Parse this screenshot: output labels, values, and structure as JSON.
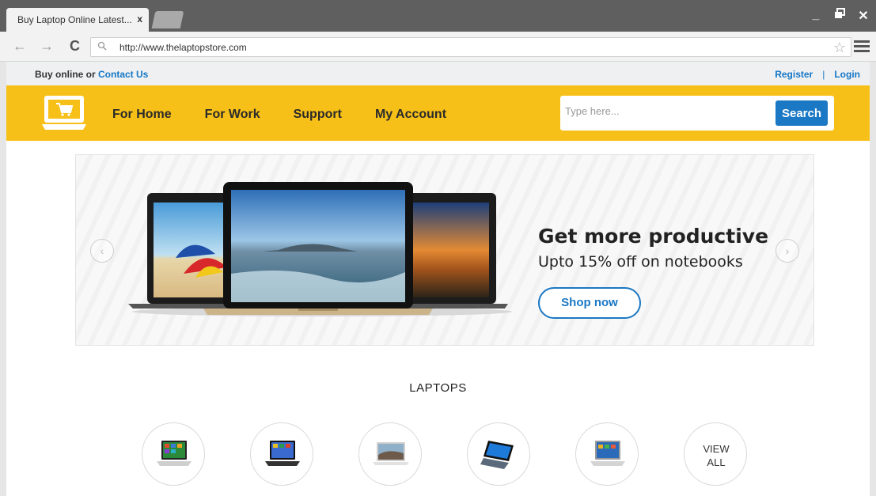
{
  "browser": {
    "tab_title": "Buy Laptop Online Latest...",
    "tab_close": "x",
    "url": "http://www.thelaptopstore.com",
    "icons": [
      "back-arrow-icon",
      "forward-arrow-icon",
      "reload-icon",
      "search-icon",
      "star-icon",
      "menu-icon",
      "minimize-icon",
      "restore-icon",
      "close-icon"
    ]
  },
  "topbar": {
    "buy_text": "Buy online or ",
    "contact_link": "Contact Us",
    "register": "Register",
    "separator": "|",
    "login": "Login"
  },
  "header": {
    "nav": [
      "For Home",
      "For Work",
      "Support",
      "My Account"
    ],
    "search_placeholder": "Type here...",
    "search_button": "Search",
    "logo_icon": "cart-laptop-icon",
    "accent_color": "#f7c018",
    "brand_blue": "#1b78c4"
  },
  "banner": {
    "headline": "Get more productive",
    "subline": "Upto 15% off on notebooks",
    "cta": "Shop now",
    "prev_icon": "chevron-left-icon",
    "next_icon": "chevron-right-icon"
  },
  "laptops": {
    "title": "LAPTOPS",
    "view_all_line1": "VIEW",
    "view_all_line2": "ALL"
  }
}
